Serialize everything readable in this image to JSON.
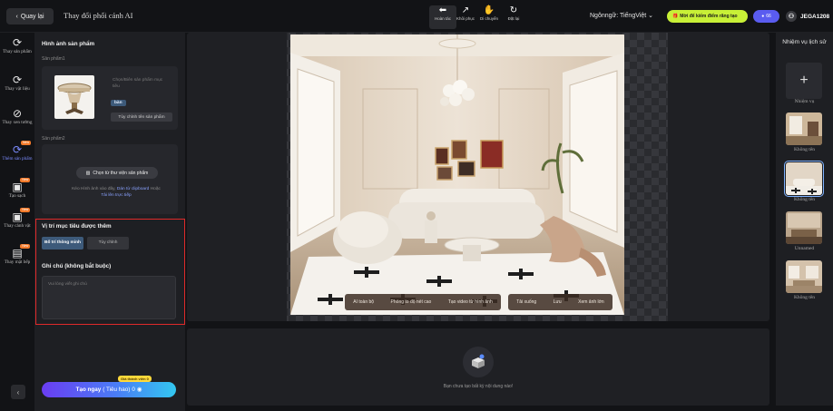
{
  "topbar": {
    "back_label": "Quay lại",
    "title": "Thay đổi phối cảnh AI",
    "tools": [
      {
        "icon": "undo-icon",
        "label": "Hoàn tác"
      },
      {
        "icon": "redo-icon",
        "label": "Khôi phục"
      },
      {
        "icon": "hand-move-icon",
        "label": "Di chuyển"
      },
      {
        "icon": "reset-icon",
        "label": "Đặt lại"
      }
    ],
    "language": "Ngônngữ: TiếngViệt",
    "promo": "Mời để kiếm điểm răng tạo",
    "credits": "66",
    "username": "JEGA1208"
  },
  "rail": {
    "items": [
      {
        "label": "Thay sản phẩm",
        "icon": "swap-product-icon"
      },
      {
        "label": "Thay vật liệu",
        "icon": "material-icon"
      },
      {
        "label": "Thay xen tường",
        "icon": "wall-icon"
      },
      {
        "label": "Thêm sản phẩm",
        "icon": "add-product-icon",
        "badge": "New"
      },
      {
        "label": "Tạo sạch",
        "icon": "clean-icon",
        "badge": "New"
      },
      {
        "label": "Thay cảnh vật",
        "icon": "scene-icon",
        "badge": "New"
      },
      {
        "label": "Thay mặt bếp",
        "icon": "kitchen-icon",
        "badge": "New"
      }
    ]
  },
  "panel": {
    "section_title": "Hình ảnh sản phẩm",
    "product1_label": "Sản phẩm1",
    "product1_hint": "Chọn/Biên sản phẩm mục tiêu",
    "product1_tag": "bàn",
    "product1_custom": "Tùy chỉnh tên sản phẩm",
    "product2_label": "Sản phẩm2",
    "pick_library": "Chọn từ thư viện sản phẩm",
    "drop_hint": "Kéo Hình ảnh vào đây,",
    "drop_paste": "Dán từ clipboard",
    "drop_or": "Hoặc",
    "drop_upload": "Tải lên trực tiếp",
    "position_title": "Vị trí mục tiêu được thêm",
    "position_smart": "Bố trí thông minh",
    "position_custom": "Tùy chỉnh",
    "note_title": "Ghi chú (không bắt buộc)",
    "note_placeholder": "Vui lòng viết ghi chú",
    "go_label": "Tạo ngay",
    "go_cost": "( Tiêu hao)",
    "go_cost_num": "0",
    "free_badge": "Giá thành viên 0"
  },
  "canvas": {
    "actions": [
      "AI toàn bộ",
      "Phóng to độ nét cao",
      "Tạo video từ hình ảnh"
    ],
    "actions2": [
      "Tải xuống",
      "Lưu",
      "Xem ảnh lớn"
    ]
  },
  "bottom": {
    "empty_text": "Bạn chưa tạo bất kỳ nội dung nào!"
  },
  "history": {
    "title": "Nhiệm vụ lịch sử",
    "new_label": "Nhiệm vụ",
    "items": [
      {
        "label": "Không tên"
      },
      {
        "label": "Không tên"
      },
      {
        "label": "Unnamed"
      },
      {
        "label": "Không tên"
      }
    ]
  },
  "colors": {
    "accent": "#5a5cf0",
    "highlight_border": "#e02a2a",
    "promo": "#c8f037"
  }
}
